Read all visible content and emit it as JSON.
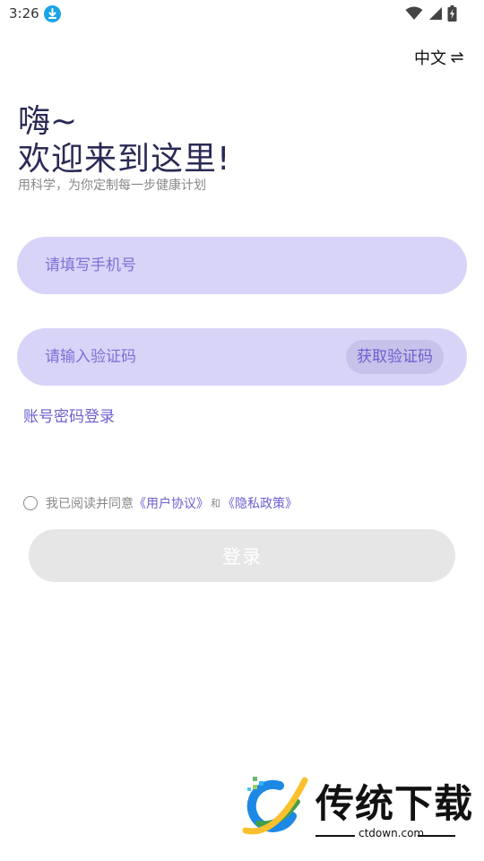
{
  "status_bar": {
    "time": "3:26",
    "download_icon": "download-icon",
    "wifi_icon": "wifi-icon",
    "signal_icon": "signal-icon",
    "battery_icon": "battery-charging-icon"
  },
  "lang_switch": {
    "label": "中文",
    "icon": "swap-arrows-icon"
  },
  "greeting": {
    "line1": "嗨~",
    "line2": "欢迎来到这里!",
    "subtitle": "用科学，为你定制每一步健康计划"
  },
  "phone_input": {
    "placeholder": "请填写手机号",
    "value": ""
  },
  "code_input": {
    "placeholder": "请输入验证码",
    "value": "",
    "get_code_label": "获取验证码"
  },
  "password_login_link": "账号密码登录",
  "agreement": {
    "prefix": "我已阅读并同意",
    "user_agreement": "《用户协议》",
    "and": "和",
    "privacy_policy": "《隐私政策》"
  },
  "login_button": "登录",
  "watermark": {
    "title": "传统下载",
    "url": "ctdown.com"
  },
  "colors": {
    "accent": "#6a5fd0",
    "input_bg": "#d8d4f8",
    "disabled_button": "#e6e6e6",
    "heading": "#2a2a55"
  }
}
